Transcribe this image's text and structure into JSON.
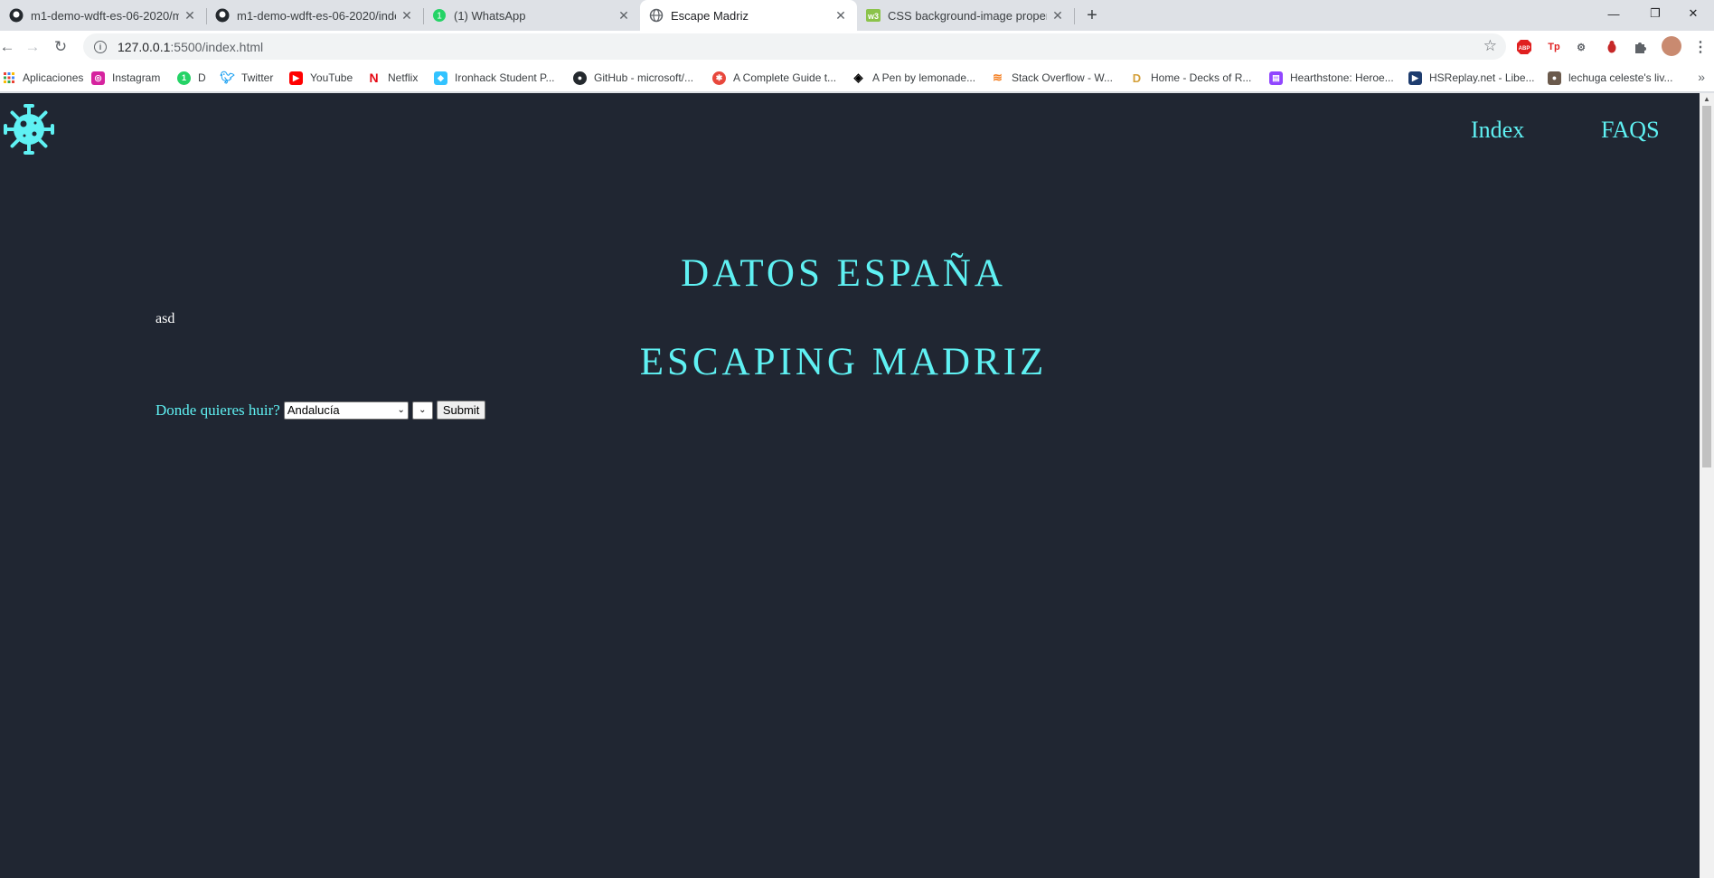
{
  "tabs": [
    {
      "title": "m1-demo-wdft-es-06-2020/main",
      "icon": "github-icon"
    },
    {
      "title": "m1-demo-wdft-es-06-2020/inde",
      "icon": "github-icon"
    },
    {
      "title": "(1) WhatsApp",
      "icon": "whatsapp-icon"
    },
    {
      "title": "Escape Madriz",
      "icon": "globe-icon"
    },
    {
      "title": "CSS background-image property",
      "icon": "w3schools-icon"
    }
  ],
  "address": {
    "host": "127.0.0.1",
    "path": ":5500/index.html"
  },
  "bookmarks": [
    {
      "label": "Aplicaciones"
    },
    {
      "label": "Instagram"
    },
    {
      "label": "D"
    },
    {
      "label": "Twitter"
    },
    {
      "label": "YouTube"
    },
    {
      "label": "Netflix"
    },
    {
      "label": "Ironhack Student P..."
    },
    {
      "label": "GitHub - microsoft/..."
    },
    {
      "label": "A Complete Guide t..."
    },
    {
      "label": "A Pen by lemonade..."
    },
    {
      "label": "Stack Overflow - W..."
    },
    {
      "label": "Home - Decks of R..."
    },
    {
      "label": "Hearthstone: Heroe..."
    },
    {
      "label": "HSReplay.net - Libe..."
    },
    {
      "label": "lechuga celeste's liv..."
    }
  ],
  "extensions": {
    "abp": "ABP",
    "tp": "Tp"
  },
  "page": {
    "nav": {
      "index": "Index",
      "faqs": "FAQS"
    },
    "heading1": "DATOS ESPAÑA",
    "asd": "asd",
    "heading2": "ESCAPING MADRIZ",
    "form": {
      "label": "Donde quieres huir?",
      "region_value": "Andalucía",
      "submit": "Submit"
    }
  },
  "colors": {
    "page_bg": "#202632",
    "accent": "#5ff1f3"
  }
}
